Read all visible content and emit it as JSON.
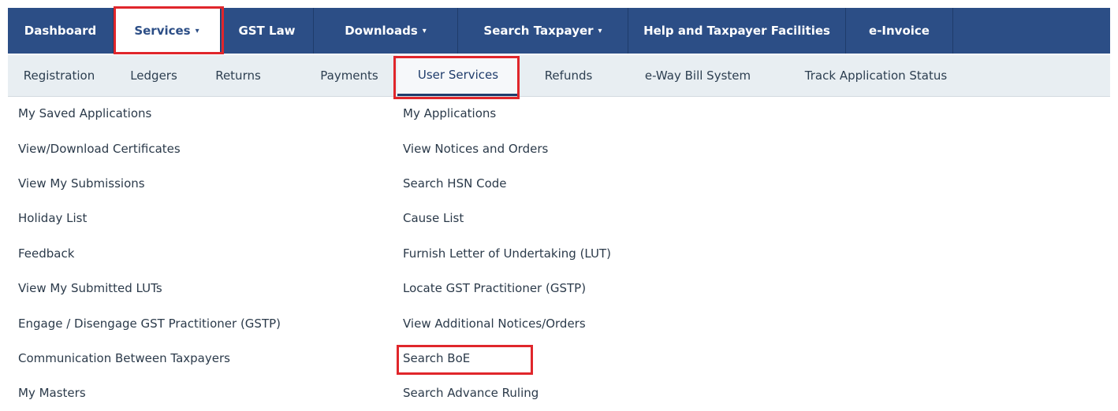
{
  "top_nav": {
    "items": [
      {
        "label": "Dashboard"
      },
      {
        "label": "Services",
        "caret": "▾"
      },
      {
        "label": "GST Law"
      },
      {
        "label": "Downloads",
        "caret": "▾"
      },
      {
        "label": "Search Taxpayer",
        "caret": "▾"
      },
      {
        "label": "Help and Taxpayer Facilities"
      },
      {
        "label": "e-Invoice"
      }
    ],
    "active": "Services",
    "bg_color": "#2c4e86"
  },
  "sub_nav": {
    "items": [
      {
        "label": "Registration"
      },
      {
        "label": "Ledgers"
      },
      {
        "label": "Returns"
      },
      {
        "label": "Payments"
      },
      {
        "label": "User Services"
      },
      {
        "label": "Refunds"
      },
      {
        "label": "e-Way Bill System"
      },
      {
        "label": "Track Application Status"
      }
    ],
    "active": "User Services"
  },
  "menu": {
    "left": [
      "My Saved Applications",
      "View/Download Certificates",
      "View My Submissions",
      "Holiday List",
      "Feedback",
      "View My Submitted LUTs",
      "Engage / Disengage GST Practitioner (GSTP)",
      "Communication Between Taxpayers",
      "My Masters"
    ],
    "right": [
      "My Applications",
      "View Notices and Orders",
      "Search HSN Code",
      "Cause List",
      "Furnish Letter of Undertaking (LUT)",
      "Locate GST Practitioner (GSTP)",
      "View Additional Notices/Orders",
      "Search BoE",
      "Search Advance Ruling"
    ]
  },
  "highlight_color": "#e0262b"
}
